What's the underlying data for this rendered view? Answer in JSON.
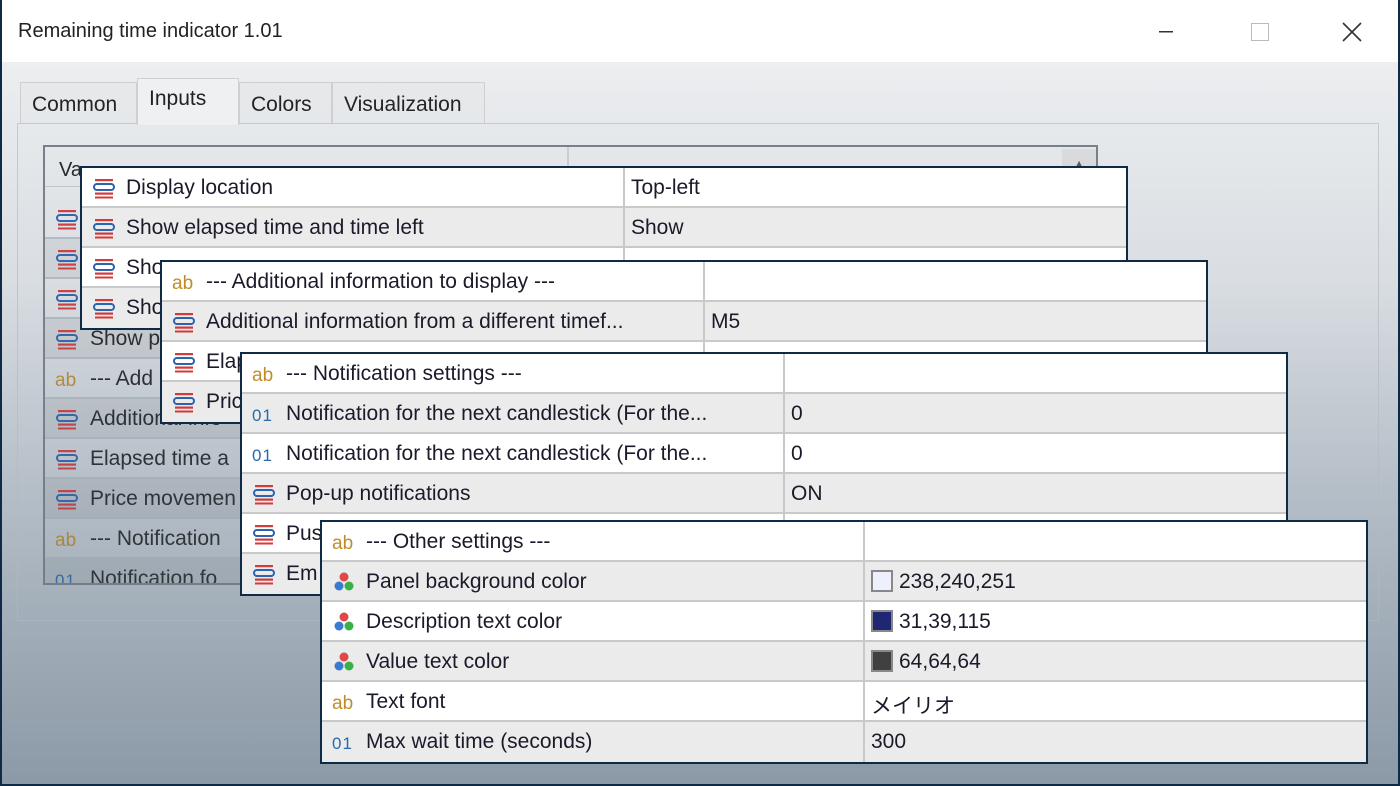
{
  "window": {
    "title": "Remaining time indicator 1.01",
    "controls": [
      "minimize",
      "maximize",
      "close"
    ]
  },
  "tabs": [
    {
      "label": "Common"
    },
    {
      "label": "Inputs",
      "active": true
    },
    {
      "label": "Colors"
    },
    {
      "label": "Visualization"
    }
  ],
  "background_table": {
    "header": {
      "variable": "Va",
      "value": ""
    },
    "rows": [
      {
        "icon": "enum",
        "label": ""
      },
      {
        "icon": "enum",
        "label": ""
      },
      {
        "icon": "enum",
        "label": ""
      },
      {
        "icon": "enum",
        "label": "Show p"
      },
      {
        "icon": "ab",
        "label": "--- Add"
      },
      {
        "icon": "enum",
        "label": "Additional info"
      },
      {
        "icon": "enum",
        "label": "Elapsed time a"
      },
      {
        "icon": "enum",
        "label": "Price movemen"
      },
      {
        "icon": "ab",
        "label": "--- Notification"
      },
      {
        "icon": "01",
        "label": "Notification fo"
      }
    ]
  },
  "panels": [
    {
      "rows": [
        {
          "icon": "enum",
          "label": "Display location",
          "value": "Top-left"
        },
        {
          "icon": "enum",
          "label": "Show elapsed time and time left",
          "value": "Show"
        },
        {
          "icon": "enum",
          "label": "Sho",
          "value": ""
        },
        {
          "icon": "enum",
          "label": "Sho",
          "value": ""
        }
      ]
    },
    {
      "rows": [
        {
          "icon": "ab",
          "label": "--- Additional information to display ---",
          "value": ""
        },
        {
          "icon": "enum",
          "label": "Additional information from a different timef...",
          "value": "M5"
        },
        {
          "icon": "enum",
          "label": "Elap",
          "value": ""
        },
        {
          "icon": "enum",
          "label": "Pric",
          "value": ""
        }
      ]
    },
    {
      "rows": [
        {
          "icon": "ab",
          "label": "--- Notification settings ---",
          "value": ""
        },
        {
          "icon": "01",
          "label": "Notification for the next candlestick (For the...",
          "value": "0"
        },
        {
          "icon": "01",
          "label": "Notification for the next candlestick (For the...",
          "value": "0"
        },
        {
          "icon": "enum",
          "label": "Pop-up notifications",
          "value": "ON"
        },
        {
          "icon": "enum",
          "label": "Pus",
          "value": ""
        },
        {
          "icon": "enum",
          "label": "Em",
          "value": ""
        }
      ]
    },
    {
      "rows": [
        {
          "icon": "ab",
          "label": "--- Other settings ---",
          "value": ""
        },
        {
          "icon": "color",
          "label": "Panel background color",
          "value": "238,240,251",
          "swatch": "#eef0fb"
        },
        {
          "icon": "color",
          "label": "Description text color",
          "value": "31,39,115",
          "swatch": "#1f2773"
        },
        {
          "icon": "color",
          "label": "Value text color",
          "value": "64,64,64",
          "swatch": "#404040"
        },
        {
          "icon": "ab",
          "label": "Text font",
          "value": "メイリオ"
        },
        {
          "icon": "01",
          "label": "Max wait time (seconds)",
          "value": "300"
        }
      ]
    }
  ],
  "colors": {
    "panel_border": "#0e2a45",
    "ab_icon": "#c08c2a",
    "num_icon": "#2a6aaa"
  }
}
